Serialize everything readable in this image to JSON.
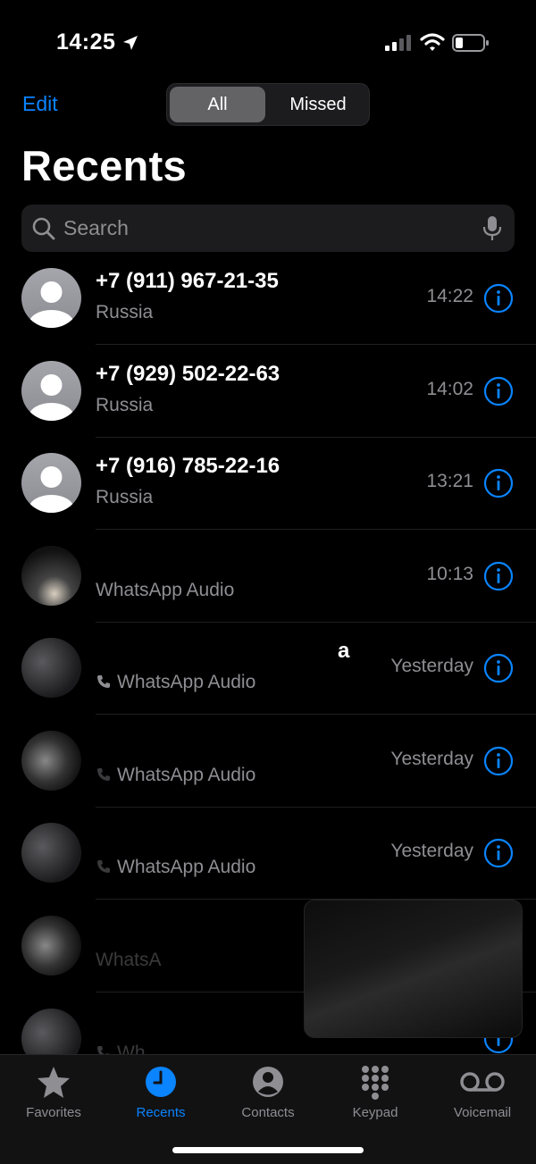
{
  "status": {
    "time": "14:25"
  },
  "nav": {
    "edit_label": "Edit",
    "segments": [
      {
        "label": "All"
      },
      {
        "label": "Missed"
      }
    ]
  },
  "title": "Recents",
  "search": {
    "placeholder": "Search"
  },
  "colors": {
    "accent": "#0a84ff",
    "secondary_text": "#8e8e93"
  },
  "calls": [
    {
      "name": "+7 (911) 967-21-35",
      "subtitle": "Russia",
      "time": "14:22"
    },
    {
      "name": "+7 (929) 502-22-63",
      "subtitle": "Russia",
      "time": "14:02"
    },
    {
      "name": "+7 (916) 785-22-16",
      "subtitle": "Russia",
      "time": "13:21"
    },
    {
      "name": "",
      "subtitle": "WhatsApp Audio",
      "time": "10:13"
    },
    {
      "name": "а",
      "subtitle": "WhatsApp Audio",
      "time": "Yesterday"
    },
    {
      "name": "",
      "subtitle": "WhatsApp Audio",
      "time": "Yesterday"
    },
    {
      "name": "",
      "subtitle": "WhatsApp Audio",
      "time": "Yesterday"
    },
    {
      "name": "",
      "subtitle": "WhatsA",
      "time": ""
    },
    {
      "name": "",
      "subtitle": "Wh",
      "time": ""
    }
  ],
  "tabs": [
    {
      "label": "Favorites",
      "icon": "star-icon"
    },
    {
      "label": "Recents",
      "icon": "clock-icon"
    },
    {
      "label": "Contacts",
      "icon": "person-circle-icon"
    },
    {
      "label": "Keypad",
      "icon": "keypad-icon"
    },
    {
      "label": "Voicemail",
      "icon": "voicemail-icon"
    }
  ]
}
